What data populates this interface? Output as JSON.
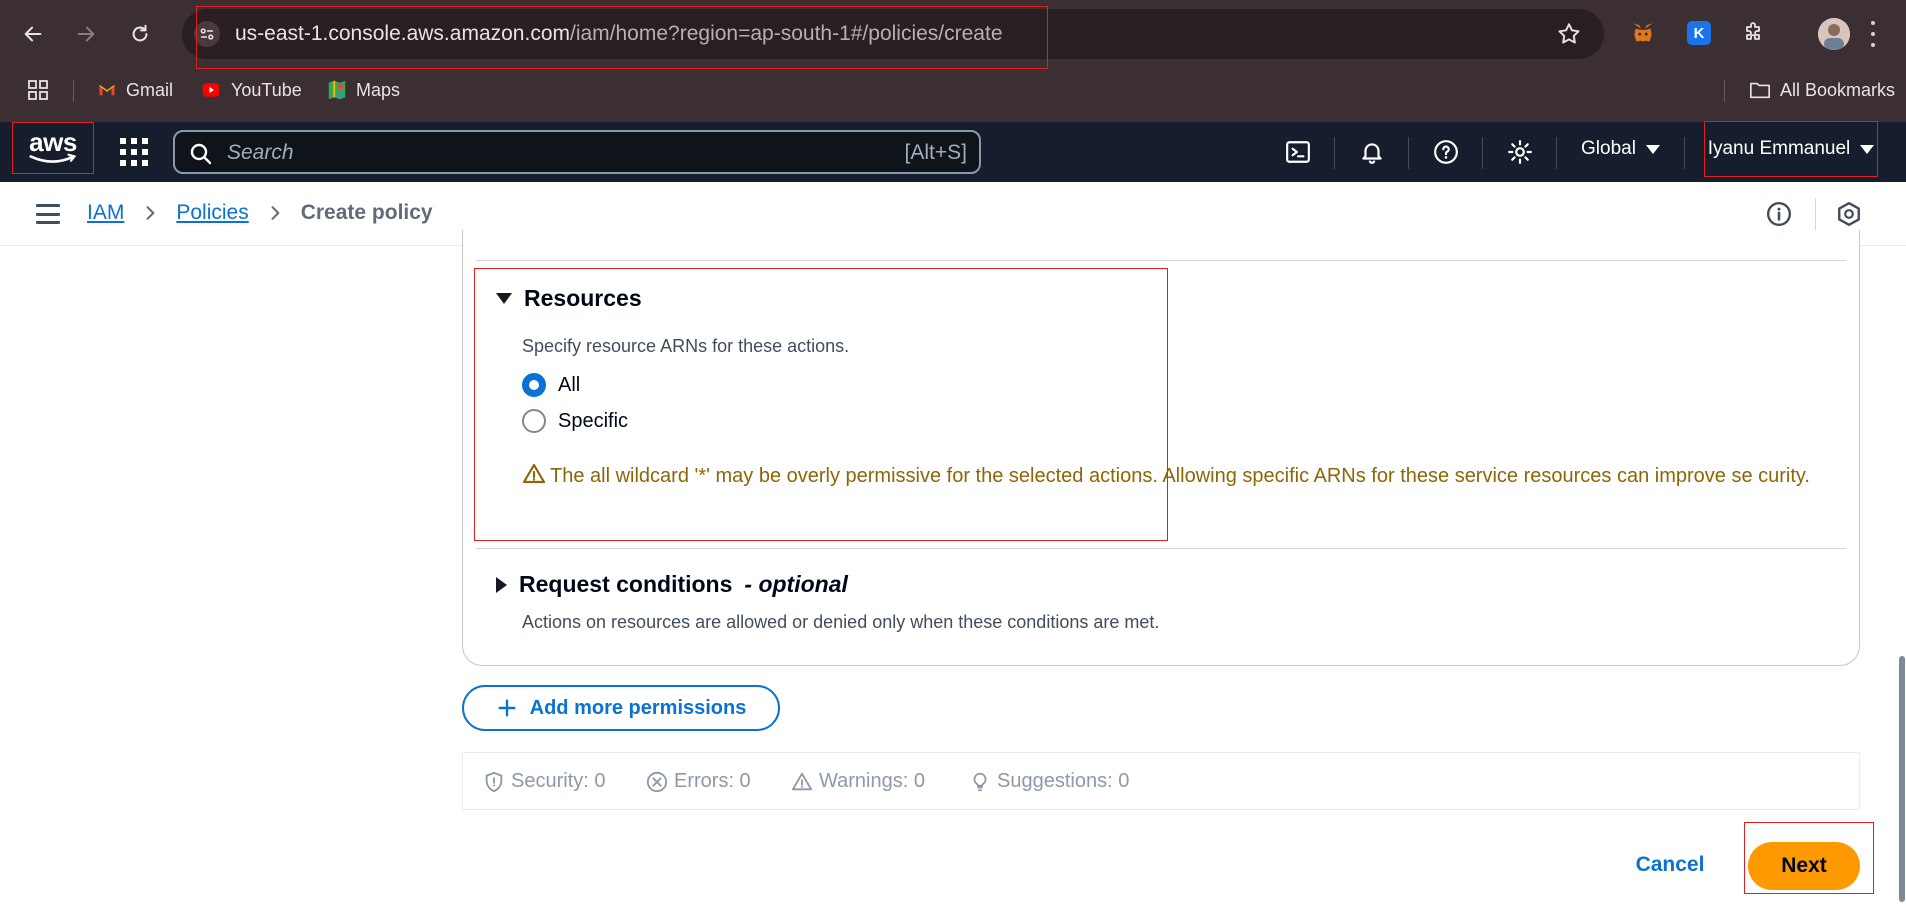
{
  "browser": {
    "url_host": "us-east-1.console.aws.amazon.com",
    "url_path": "/iam/home?region=ap-south-1#/policies/create",
    "bookmarks": [
      "Gmail",
      "YouTube",
      "Maps"
    ],
    "all_bookmarks": "All Bookmarks"
  },
  "aws_header": {
    "logo_text": "aws",
    "search_placeholder": "Search",
    "search_shortcut": "[Alt+S]",
    "region": "Global",
    "user": "Iyanu Emmanuel"
  },
  "breadcrumb": {
    "items": [
      "IAM",
      "Policies"
    ],
    "current": "Create policy"
  },
  "resources": {
    "title": "Resources",
    "description": "Specify resource ARNs for these actions.",
    "options": [
      {
        "label": "All",
        "selected": true
      },
      {
        "label": "Specific",
        "selected": false
      }
    ],
    "warning": "The all wildcard '*' may be overly permissive for the selected actions. Allowing specific ARNs for these service resources can improve se curity."
  },
  "request_conditions": {
    "title": "Request conditions",
    "optional_label": "- optional",
    "description": "Actions on resources are allowed or denied only when these conditions are met."
  },
  "add_permissions_label": "Add more permissions",
  "summary": {
    "security": "Security: 0",
    "errors": "Errors: 0",
    "warnings": "Warnings: 0",
    "suggestions": "Suggestions: 0"
  },
  "footer": {
    "cancel": "Cancel",
    "next": "Next"
  },
  "colors": {
    "aws_header_bg": "#161e2d",
    "link_blue": "#0972d3",
    "primary_orange": "#ff9900",
    "warning_text": "#8d6605",
    "highlight_box": "#e02020"
  }
}
